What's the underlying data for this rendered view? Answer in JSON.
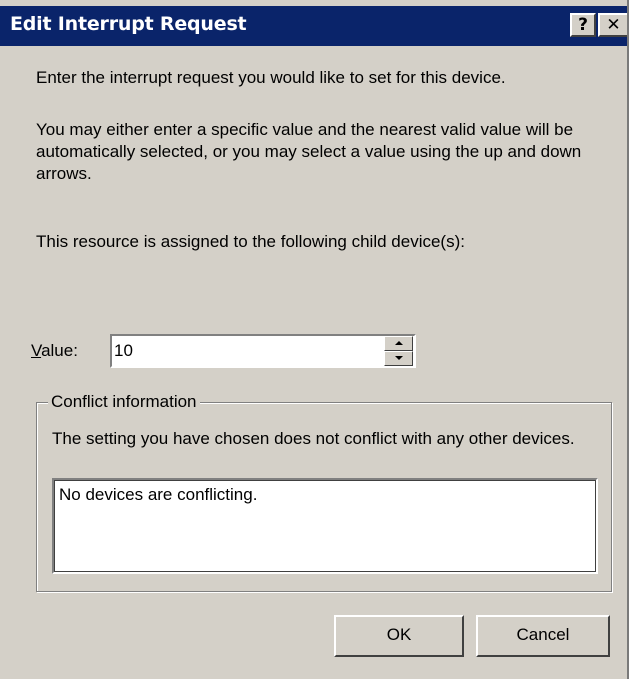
{
  "window": {
    "title": "Edit Interrupt Request",
    "help_glyph": "?",
    "close_glyph": "✕"
  },
  "instructions": {
    "intro": "Enter the interrupt request you would like to set for this device.",
    "description": "You may either enter a specific value and the nearest valid value will be automatically selected, or you may select a value using the up and down arrows.",
    "assigned": "This resource is assigned to the following child device(s):"
  },
  "value": {
    "label_mnemonic": "V",
    "label_rest": "alue:",
    "current": "10"
  },
  "conflict": {
    "legend": "Conflict information",
    "message": "The setting you have chosen does not conflict with any other devices.",
    "items": [
      "No devices are conflicting."
    ]
  },
  "buttons": {
    "ok": "OK",
    "cancel": "Cancel"
  },
  "colors": {
    "titlebar": "#0a246a",
    "face": "#d4d0c8"
  }
}
